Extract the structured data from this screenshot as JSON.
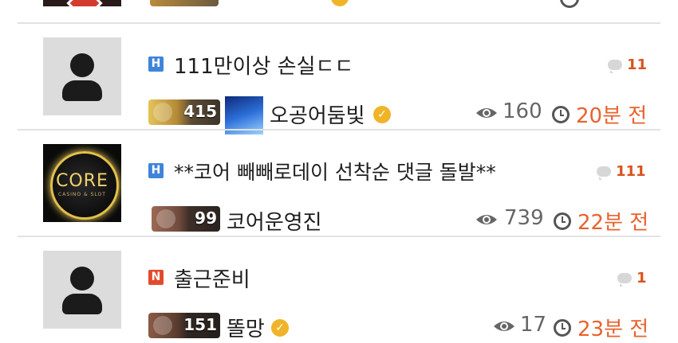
{
  "posts": [
    {
      "category": "H",
      "title": "111만이상 손실ㄷㄷ",
      "comments": "11",
      "level": "415",
      "author": "오공어둠빛",
      "views": "160",
      "time": "20분 전"
    },
    {
      "category": "H",
      "title": "**코어 빼빼로데이 선착순 댓글 돌발**",
      "comments": "111",
      "level": "99",
      "author": "코어운영진",
      "views": "739",
      "time": "22분 전",
      "thumbnail_text": "CORE",
      "thumbnail_sub": "CASINO & SLOT"
    },
    {
      "category": "N",
      "title": "출근준비",
      "comments": "1",
      "level": "151",
      "author": "똘망",
      "views": "17",
      "time": "23분 전"
    }
  ],
  "colors": {
    "accent_time": "#e8622d",
    "comment_count": "#d9531e",
    "category_h": "#3f84d8",
    "category_n": "#e24a2d",
    "verified": "#f0b429"
  },
  "icons": [
    "user-placeholder-icon",
    "comment-icon",
    "eye-icon",
    "clock-icon",
    "verified-badge-icon"
  ]
}
